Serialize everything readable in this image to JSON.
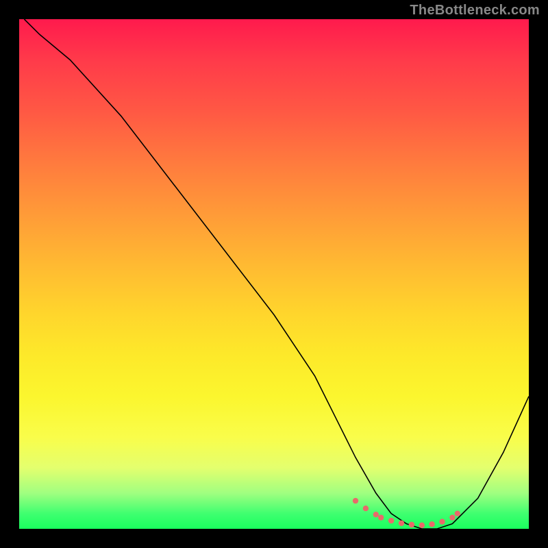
{
  "watermark": "TheBottleneck.com",
  "chart_data": {
    "type": "line",
    "title": "",
    "xlabel": "",
    "ylabel": "",
    "xlim": [
      0,
      100
    ],
    "ylim": [
      0,
      100
    ],
    "grid": false,
    "watermark_text": "TheBottleneck.com",
    "background_gradient": {
      "top": "#ff1a4d",
      "middle": "#ffd62c",
      "bottom": "#1aff5e"
    },
    "series": [
      {
        "name": "bottleneck-curve",
        "color": "#000000",
        "x": [
          1,
          4,
          10,
          20,
          30,
          40,
          50,
          58,
          62,
          66,
          70,
          73,
          76,
          79,
          82,
          85,
          90,
          95,
          100
        ],
        "y": [
          100,
          97,
          92,
          81,
          68,
          55,
          42,
          30,
          22,
          14,
          7,
          3,
          1,
          0,
          0,
          1,
          6,
          15,
          26
        ]
      }
    ],
    "highlight_points": {
      "name": "sweet-spot",
      "color": "#e86a6a",
      "x": [
        66,
        68,
        70,
        71,
        73,
        75,
        77,
        79,
        81,
        83,
        85,
        86
      ],
      "y": [
        5.5,
        4.0,
        2.8,
        2.2,
        1.6,
        1.1,
        0.8,
        0.7,
        0.9,
        1.4,
        2.2,
        3.0
      ]
    }
  }
}
